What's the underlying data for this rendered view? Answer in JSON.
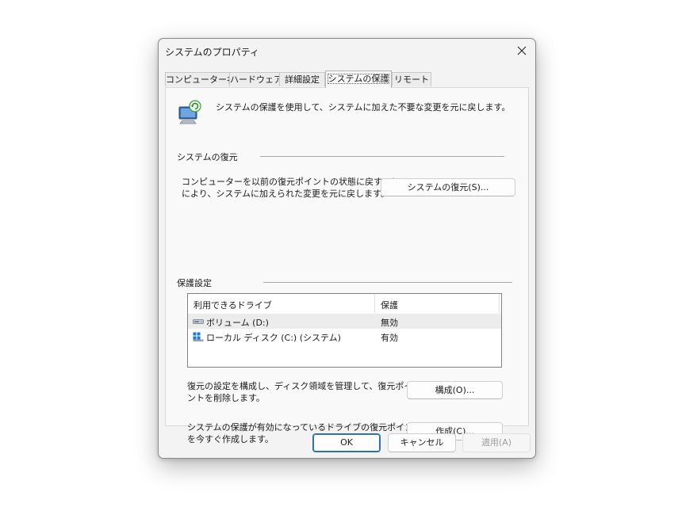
{
  "window": {
    "title": "システムのプロパティ"
  },
  "tabs": [
    {
      "label": "コンピューター名"
    },
    {
      "label": "ハードウェア"
    },
    {
      "label": "詳細設定"
    },
    {
      "label": "システムの保護",
      "active": true
    },
    {
      "label": "リモート"
    }
  ],
  "intro": {
    "text": "システムの保護を使用して、システムに加えた不要な変更を元に戻します。",
    "icon": "system-protection-icon"
  },
  "restore": {
    "heading": "システムの復元",
    "description_line1": "コンピューターを以前の復元ポイントの状態に戻すこと",
    "description_line2": "により、システムに加えられた変更を元に戻します。",
    "button_label": "システムの復元(S)..."
  },
  "protection": {
    "heading": "保護設定",
    "columns": [
      "利用できるドライブ",
      "保護"
    ],
    "drives": [
      {
        "name": "ボリューム (D:)",
        "status": "無効",
        "icon": "drive-icon"
      },
      {
        "name": "ローカル ディスク (C:) (システム)",
        "status": "有効",
        "icon": "system-drive-icon"
      }
    ],
    "configure_desc_line1": "復元の設定を構成し、ディスク領域を管理して、復元ポイ",
    "configure_desc_line2": "ントを削除します。",
    "configure_label": "構成(O)...",
    "create_desc_line1": "システムの保護が有効になっているドライブの復元ポイント",
    "create_desc_line2": "を今すぐ作成します。",
    "create_label": "作成(C)..."
  },
  "footer": {
    "ok_label": "OK",
    "cancel_label": "キャンセル",
    "apply_label": "適用(A)"
  },
  "colors": {
    "accent": "#2f6fb8",
    "window_bg": "#f3f3f3",
    "panel_bg": "#f9f9f9"
  }
}
